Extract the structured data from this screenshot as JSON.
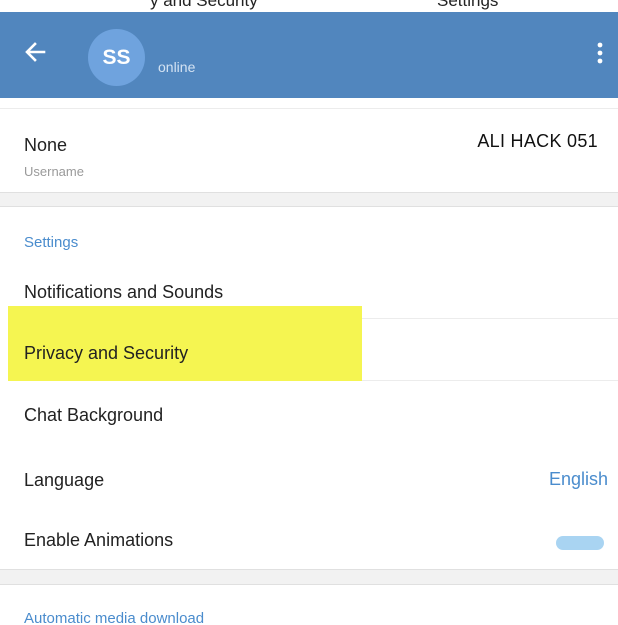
{
  "top_strip": {
    "left_text": "y and Security",
    "right_text": "Settings"
  },
  "appbar": {
    "avatar_initials": "SS",
    "status": "online",
    "color": "#5186be"
  },
  "account": {
    "username_value": "None",
    "username_label": "Username",
    "right_text": "ALI HACK 051"
  },
  "settings": {
    "section_title": "Settings",
    "items": [
      {
        "label": "Notifications and Sounds"
      },
      {
        "label": "Privacy and Security"
      },
      {
        "label": "Chat Background"
      },
      {
        "label": "Language",
        "value": "English"
      },
      {
        "label": "Enable Animations",
        "toggle": "on"
      }
    ]
  },
  "media": {
    "section_title": "Automatic media download"
  },
  "colors": {
    "accent": "#4a8ccd",
    "highlight": "#f5f551"
  },
  "icons": {
    "back": "arrow-left-icon",
    "menu": "more-vertical-icon"
  }
}
